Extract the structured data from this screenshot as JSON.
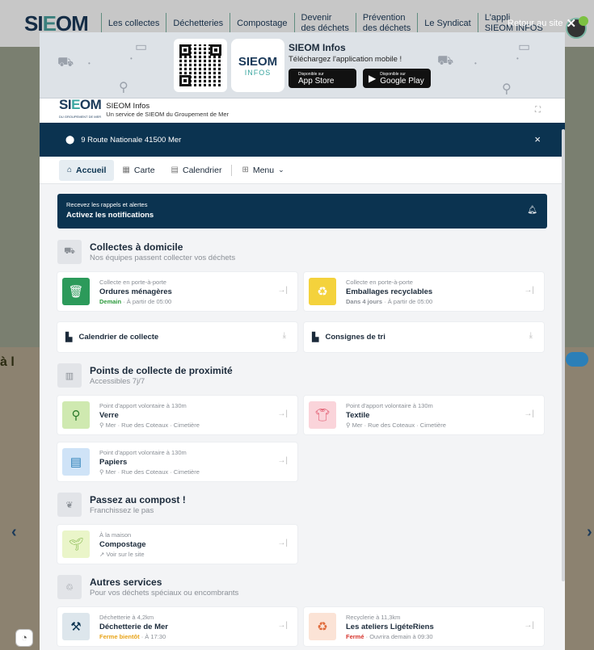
{
  "site": {
    "logo": "SIEOM",
    "nav": [
      "Les collectes",
      "Déchetteries",
      "Compostage",
      "Devenir\ndes déchets",
      "Prévention\ndes déchets",
      "Le Syndicat",
      "L'appli\nSIEOM INFOS"
    ],
    "side_label": "à l",
    "retour_label": "Retour au site",
    "retour_icon": "close-icon"
  },
  "promo": {
    "app_logo_top": "SIEOM",
    "app_logo_bottom": "INFOS",
    "title": "SIEOM Infos",
    "subtitle": "Téléchargez l'application mobile !",
    "app_store_small": "Disponible sur",
    "app_store": "App Store",
    "google_small": "Disponible sur",
    "google": "Google Play"
  },
  "header": {
    "logo": "SIEOM",
    "logo_sub": "DU GROUPEMENT DE MER",
    "app_name": "SIEOM Infos",
    "app_desc": "Un service de SIEOM du Groupement de Mer"
  },
  "address": {
    "text": "9 Route Nationale 41500 Mer",
    "close": "×"
  },
  "tabs": [
    {
      "label": "Accueil",
      "icon": "home-icon"
    },
    {
      "label": "Carte",
      "icon": "map-icon"
    },
    {
      "label": "Calendrier",
      "icon": "calendar-icon"
    },
    {
      "label": "Menu",
      "icon": "grid-icon"
    }
  ],
  "notification": {
    "line1": "Recevez les rappels et alertes",
    "line2": "Activez les notifications"
  },
  "sections": {
    "collectes": {
      "title": "Collectes à domicile",
      "subtitle": "Nos équipes passent collecter vos déchets"
    },
    "points": {
      "title": "Points de collecte de proximité",
      "subtitle": "Accessibles 7j/7"
    },
    "compost": {
      "title": "Passez au compost !",
      "subtitle": "Franchissez le pas"
    },
    "autres": {
      "title": "Autres services",
      "subtitle": "Pour vos déchets spéciaux ou encombrants"
    }
  },
  "cards": {
    "ordures": {
      "kicker": "Collecte en porte-à-porte",
      "title": "Ordures ménagères",
      "status": "Demain",
      "detail": "· À partir de 05:00"
    },
    "emballages": {
      "kicker": "Collecte en porte-à-porte",
      "title": "Emballages recyclables",
      "status": "Dans 4 jours",
      "detail": "· À partir de 05:00"
    },
    "calendrier": {
      "title": "Calendrier de collecte"
    },
    "consignes": {
      "title": "Consignes de tri"
    },
    "verre": {
      "kicker": "Point d'apport volontaire à 130m",
      "title": "Verre",
      "detail": "Mer · Rue des Coteaux · Cimetière"
    },
    "textile": {
      "kicker": "Point d'apport volontaire à 130m",
      "title": "Textile",
      "detail": "Mer · Rue des Coteaux · Cimetière"
    },
    "papiers": {
      "kicker": "Point d'apport volontaire à 130m",
      "title": "Papiers",
      "detail": "Mer · Rue des Coteaux · Cimetière"
    },
    "compostage": {
      "kicker": "À la maison",
      "title": "Compostage",
      "detail": "Voir sur le site"
    },
    "dechetterie": {
      "kicker": "Déchetterie à 4,2km",
      "title": "Déchetterie de Mer",
      "status": "Ferme bientôt",
      "detail": "· À 17:30"
    },
    "recyclerie": {
      "kicker": "Recyclerie à 11,3km",
      "title": "Les ateliers LigéteRiens",
      "status": "Fermé",
      "detail": "· Ouvrira demain à 09:30"
    }
  }
}
